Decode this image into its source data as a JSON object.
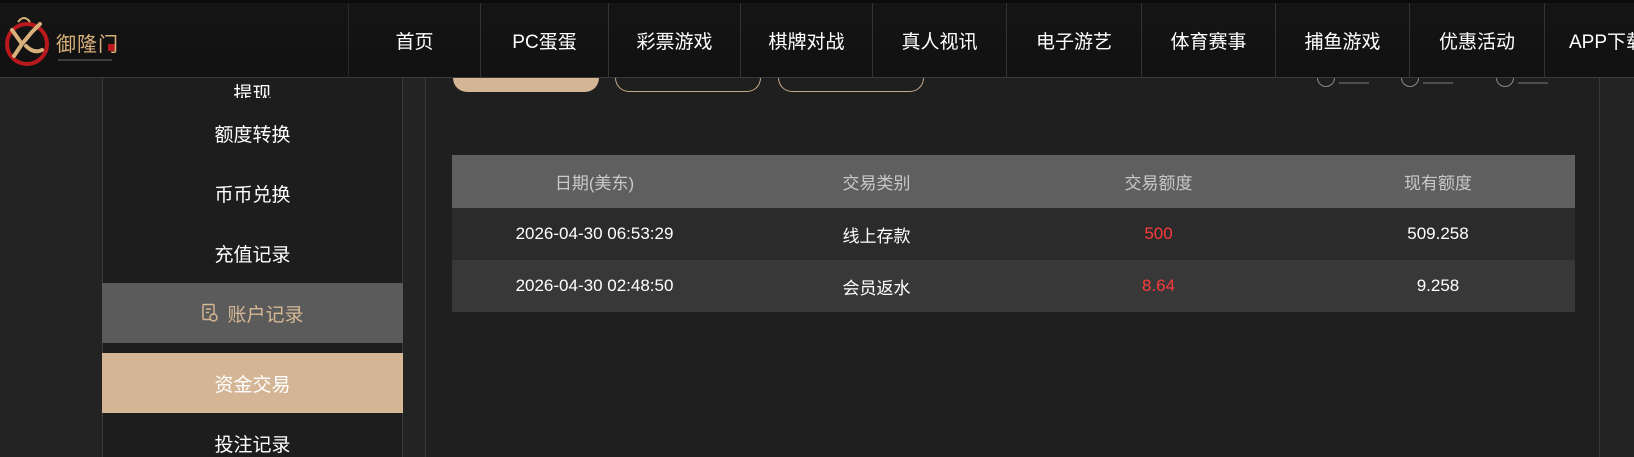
{
  "header": {
    "logo_text": "御隆门",
    "nav": [
      {
        "label": "首页"
      },
      {
        "label": "PC蛋蛋"
      },
      {
        "label": "彩票游戏"
      },
      {
        "label": "棋牌对战"
      },
      {
        "label": "真人视讯"
      },
      {
        "label": "电子游艺"
      },
      {
        "label": "体育赛事"
      },
      {
        "label": "捕鱼游戏"
      },
      {
        "label": "优惠活动"
      },
      {
        "label": "APP下载"
      }
    ]
  },
  "sidebar": {
    "items": [
      {
        "label": "提现"
      },
      {
        "label": "额度转换"
      },
      {
        "label": "币币兑换"
      },
      {
        "label": "充值记录"
      },
      {
        "label": "账户记录",
        "icon": "record-icon"
      },
      {
        "label": "资金交易"
      },
      {
        "label": "投注记录"
      }
    ]
  },
  "table": {
    "headers": [
      "日期(美东)",
      "交易类别",
      "交易额度",
      "现有额度"
    ],
    "rows": [
      {
        "date": "2026-04-30 06:53:29",
        "type": "线上存款",
        "amount": "500",
        "balance": "509.258"
      },
      {
        "date": "2026-04-30 02:48:50",
        "type": "会员返水",
        "amount": "8.64",
        "balance": "9.258"
      }
    ]
  },
  "colors": {
    "accent": "#d4b596",
    "amount": "#ff3a3a",
    "header_bg": "#5f5f5f"
  }
}
